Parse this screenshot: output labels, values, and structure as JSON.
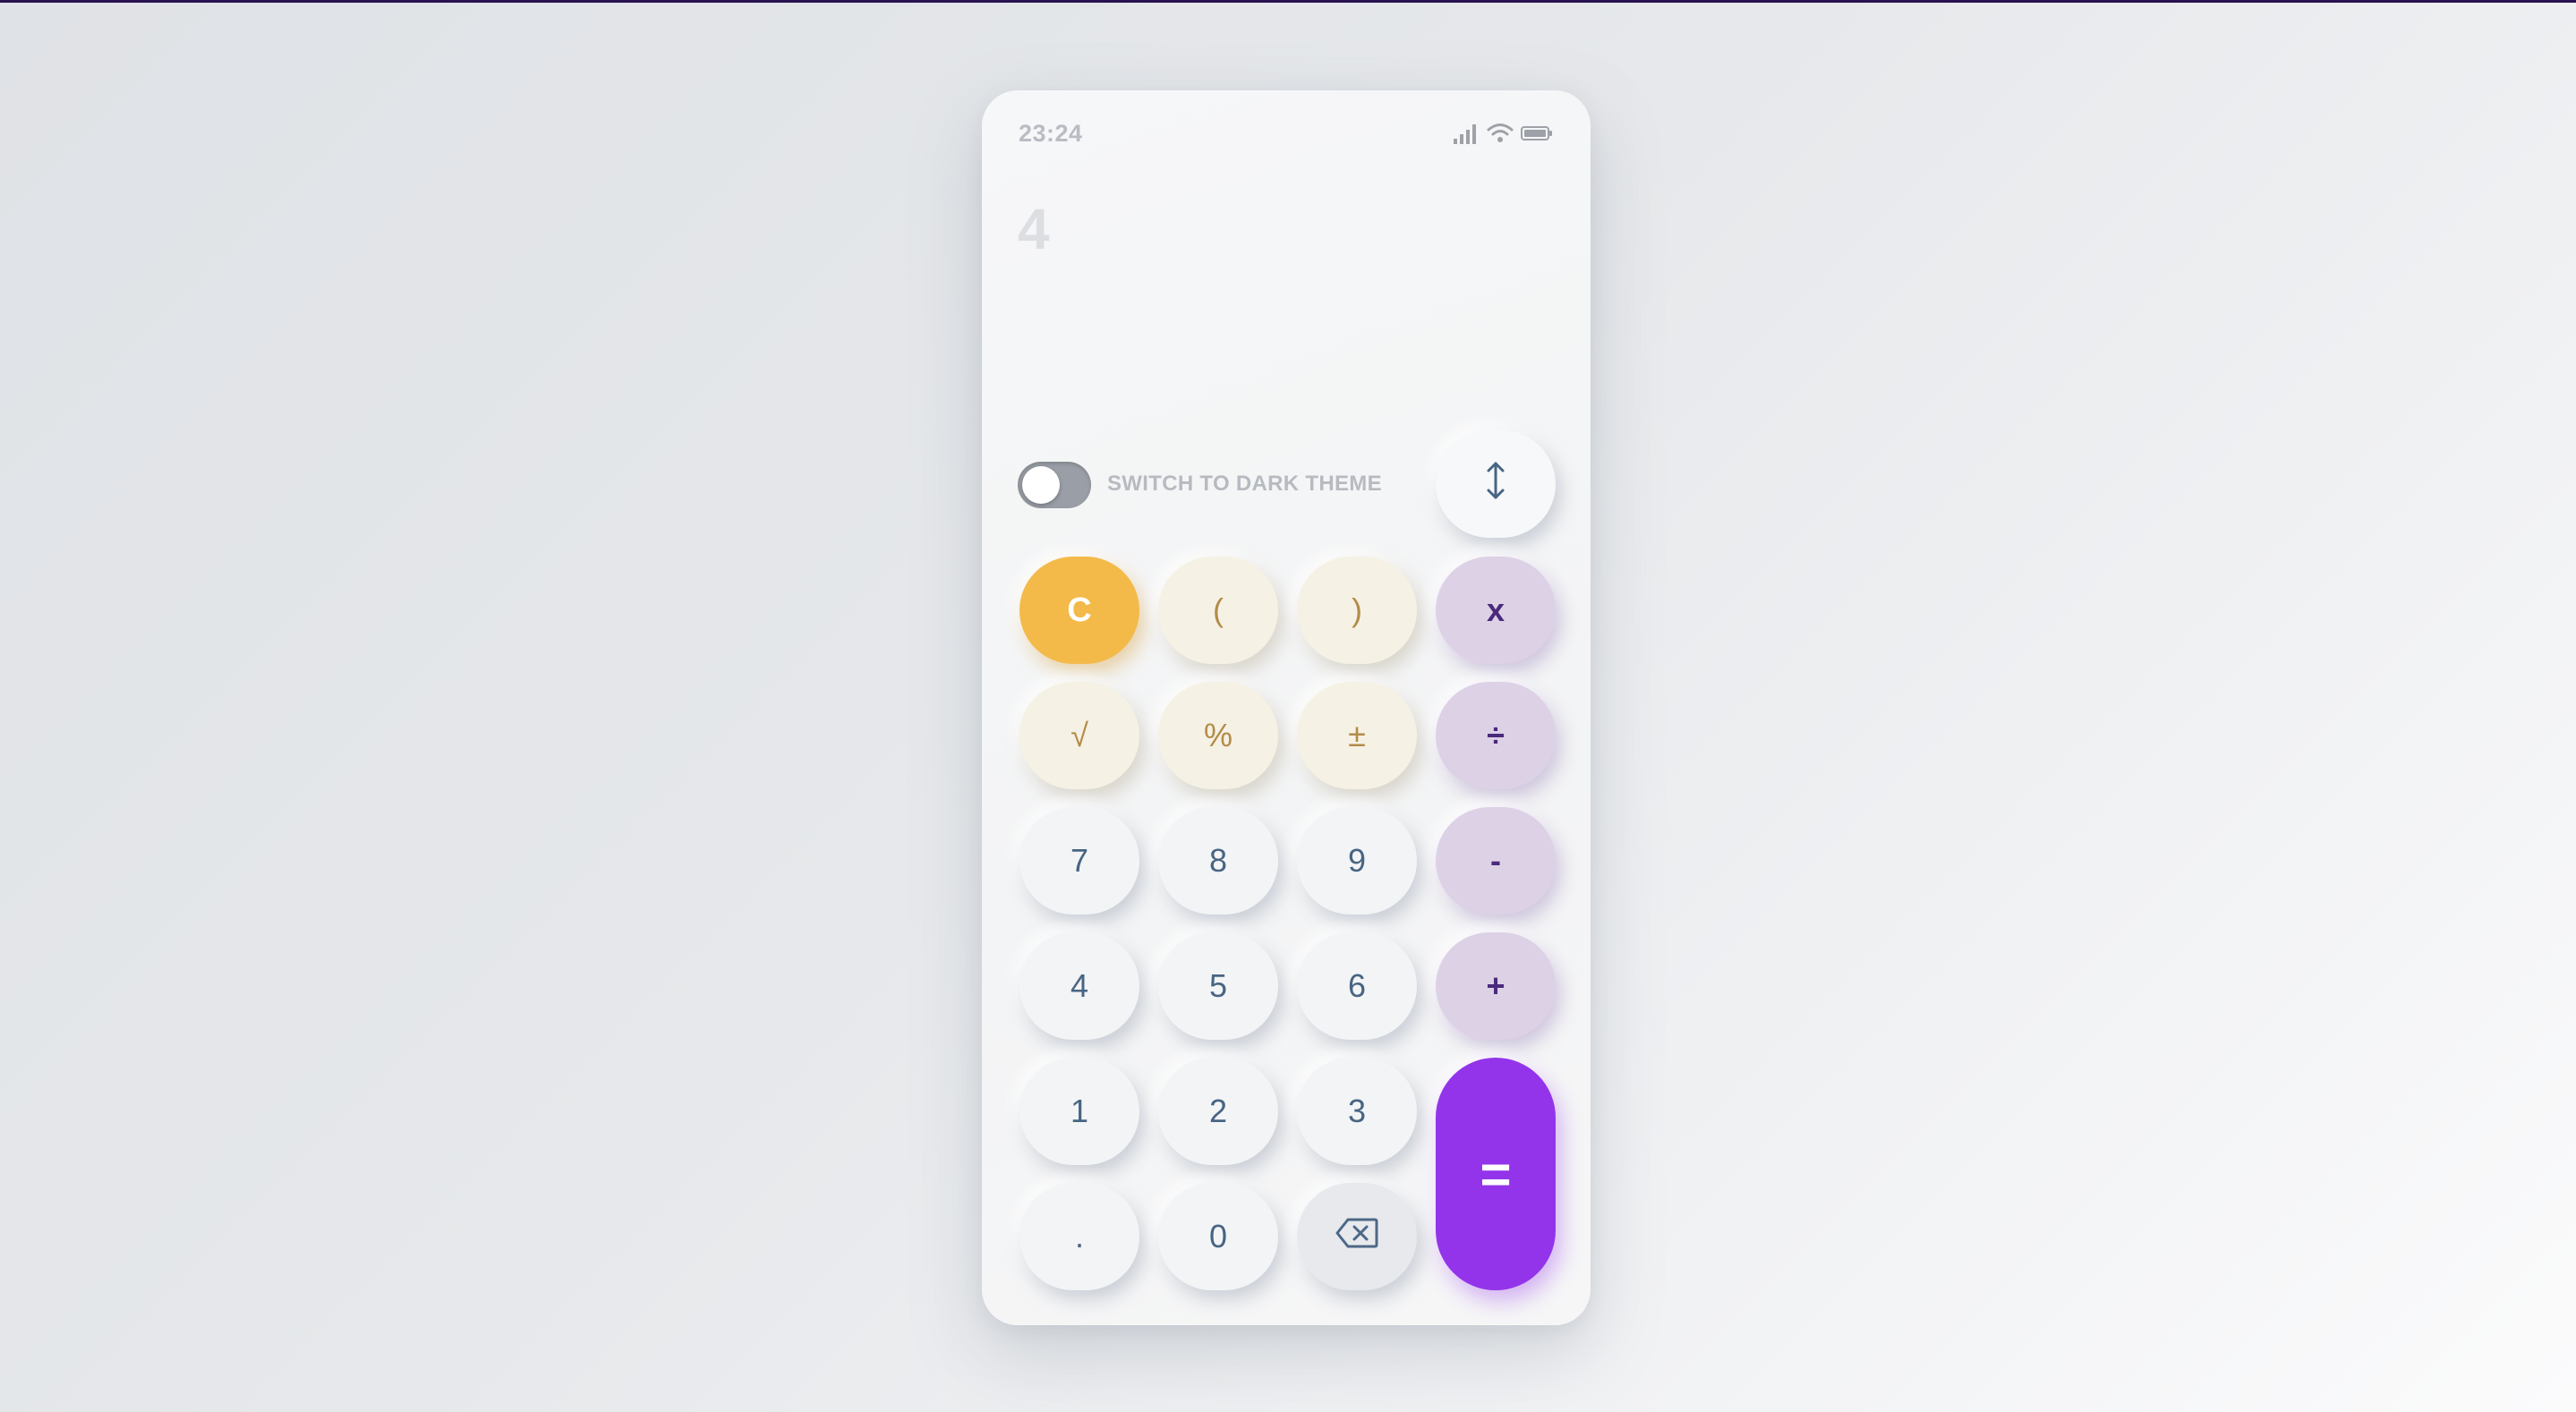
{
  "status_bar": {
    "time": "23:24",
    "icons": [
      "signal-icon",
      "wifi-icon",
      "battery-icon"
    ]
  },
  "display": {
    "value": "4"
  },
  "theme_switch": {
    "label": "SWITCH TO DARK THEME",
    "on": false
  },
  "keys": {
    "swap": "↕",
    "clear": "C",
    "open_paren": "(",
    "close_paren": ")",
    "multiply": "x",
    "sqrt": "√",
    "percent": "%",
    "plus_minus": "±",
    "divide": "÷",
    "seven": "7",
    "eight": "8",
    "nine": "9",
    "minus": "-",
    "four": "4",
    "five": "5",
    "six": "6",
    "plus": "+",
    "one": "1",
    "two": "2",
    "three": "3",
    "equals": "=",
    "decimal": ".",
    "zero": "0",
    "backspace_icon": "backspace-icon"
  },
  "colors": {
    "accent": "#9334ea",
    "clear": "#f3ba4a",
    "operator_bg": "#ddd1e6",
    "function_bg": "#f5f1e4",
    "number_text": "#476583"
  }
}
